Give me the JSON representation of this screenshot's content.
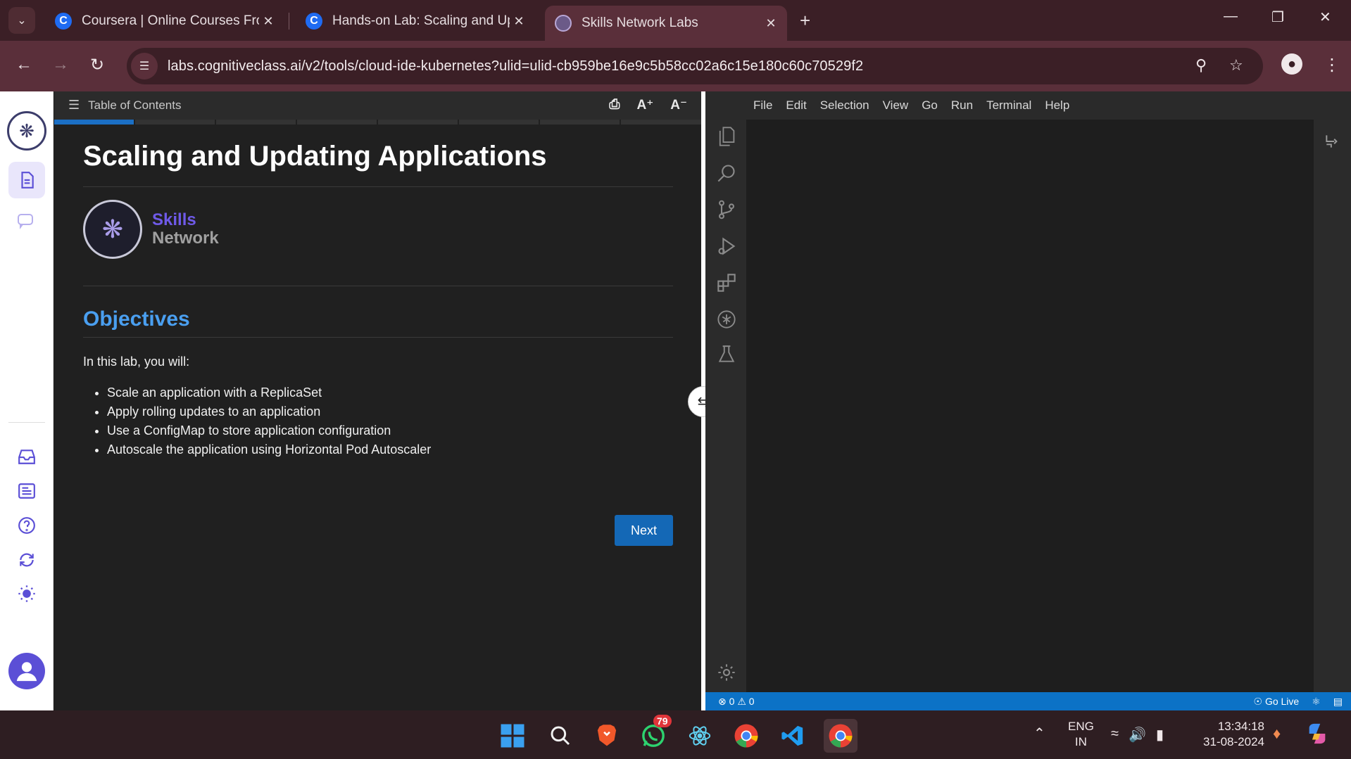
{
  "browser": {
    "tabs": [
      {
        "title": "Coursera | Online Courses From",
        "favicon": "C"
      },
      {
        "title": "Hands-on Lab: Scaling and Upd",
        "favicon": "C"
      },
      {
        "title": "Skills Network Labs",
        "favicon": ""
      }
    ],
    "url": "labs.cognitiveclass.ai/v2/tools/cloud-ide-kubernetes?ulid=ulid-cb959be16e9c5b58cc02a6c15e180c60c70529f2"
  },
  "instructions": {
    "toc_label": "Table of Contents",
    "font_increase": "A⁺",
    "font_decrease": "A⁻",
    "title": "Scaling and Updating Applications",
    "brand_line1": "Skills",
    "brand_line2": "Network",
    "objectives_heading": "Objectives",
    "intro": "In this lab, you will:",
    "objectives": [
      "Scale an application with a ReplicaSet",
      "Apply rolling updates to an application",
      "Use a ConfigMap to store application configuration",
      "Autoscale the application using Horizontal Pod Autoscaler"
    ],
    "next_label": "Next",
    "progress_fraction": 0.125
  },
  "ide": {
    "menu": [
      "File",
      "Edit",
      "Selection",
      "View",
      "Go",
      "Run",
      "Terminal",
      "Help"
    ],
    "status_errors": "0",
    "status_warnings": "0",
    "go_live": "Go Live"
  },
  "taskbar": {
    "whatsapp_badge": "79",
    "lang_line1": "ENG",
    "lang_line2": "IN",
    "time": "13:34:18",
    "date": "31-08-2024"
  }
}
